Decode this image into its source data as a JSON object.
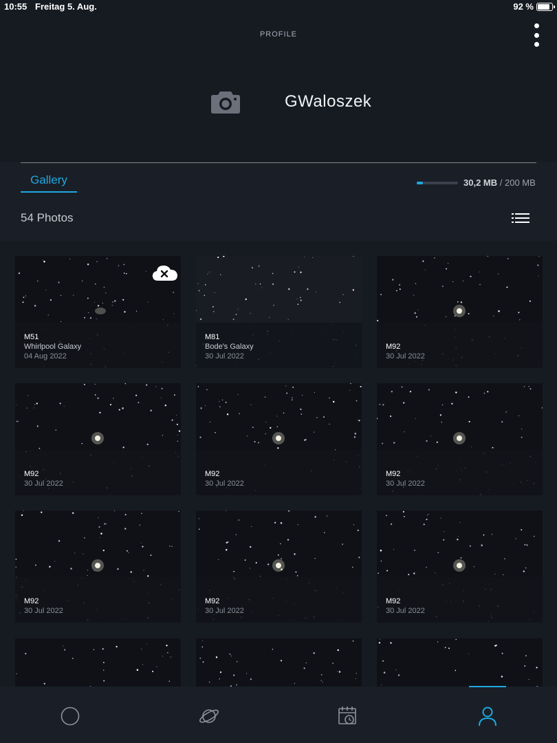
{
  "status_bar": {
    "time": "10:55",
    "date": "Freitag 5. Aug.",
    "battery": "92 %"
  },
  "header": {
    "title": "PROFILE",
    "more_icon": "more-vertical-icon"
  },
  "profile": {
    "avatar_icon": "camera-icon",
    "username": "GWaloszek"
  },
  "gallery": {
    "tab_label": "Gallery",
    "storage_used": "30,2 MB",
    "storage_total": "/ 200 MB",
    "storage_fraction": 0.151,
    "photo_count": "54 Photos",
    "view_toggle_icon": "list-view-icon",
    "photos": [
      {
        "name": "M51",
        "subtitle": "Whirlpool Galaxy",
        "date": "04 Aug 2022",
        "cloud_badge": true
      },
      {
        "name": "M81",
        "subtitle": "Bode's Galaxy",
        "date": "30 Jul 2022",
        "cloud_badge": false
      },
      {
        "name": "M92",
        "subtitle": "",
        "date": "30 Jul 2022",
        "cloud_badge": false
      },
      {
        "name": "M92",
        "subtitle": "",
        "date": "30 Jul 2022",
        "cloud_badge": false
      },
      {
        "name": "M92",
        "subtitle": "",
        "date": "30 Jul 2022",
        "cloud_badge": false
      },
      {
        "name": "M92",
        "subtitle": "",
        "date": "30 Jul 2022",
        "cloud_badge": false
      },
      {
        "name": "M92",
        "subtitle": "",
        "date": "30 Jul 2022",
        "cloud_badge": false
      },
      {
        "name": "M92",
        "subtitle": "",
        "date": "30 Jul 2022",
        "cloud_badge": false
      },
      {
        "name": "M92",
        "subtitle": "",
        "date": "30 Jul 2022",
        "cloud_badge": false
      },
      {
        "name": "",
        "subtitle": "",
        "date": "",
        "cloud_badge": false
      },
      {
        "name": "",
        "subtitle": "",
        "date": "",
        "cloud_badge": false
      },
      {
        "name": "",
        "subtitle": "",
        "date": "",
        "cloud_badge": false
      }
    ]
  },
  "bottom_nav": {
    "items": [
      {
        "icon": "circle-icon",
        "active": false
      },
      {
        "icon": "planet-icon",
        "active": false
      },
      {
        "icon": "calendar-clock-icon",
        "active": false
      },
      {
        "icon": "user-icon",
        "active": true
      }
    ]
  },
  "colors": {
    "accent": "#1fa8e0",
    "background": "#161b22",
    "panel": "#1a1f27",
    "text": "#e8eaee",
    "muted": "#8a9099"
  }
}
